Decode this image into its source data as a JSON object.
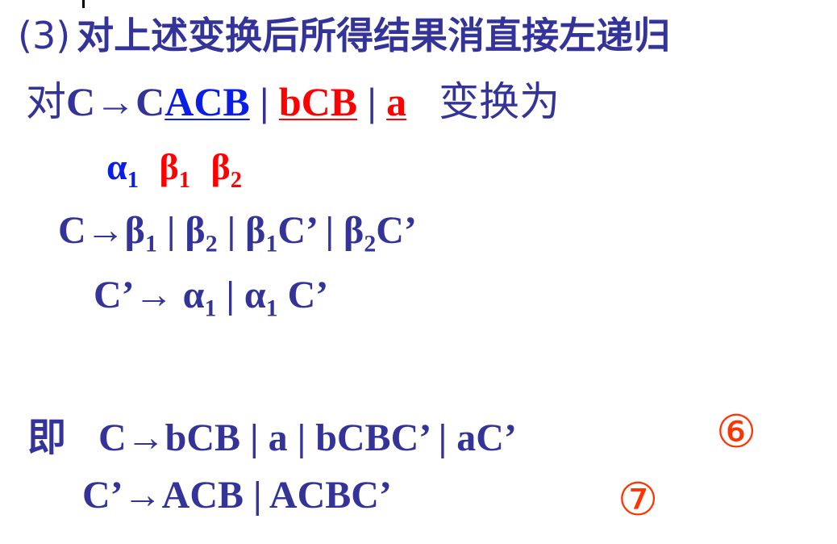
{
  "title": {
    "number": "(3)",
    "text": "对上述变换后所得结果消直接左递归"
  },
  "rule": {
    "prefix": "对",
    "lhs": "C→C",
    "alpha1": "ACB",
    "sep1": " | ",
    "beta1": "bCB",
    "sep2": " | ",
    "beta2": "a",
    "suffix": "变换为"
  },
  "labels": {
    "alpha": "α",
    "beta": "β",
    "sub1": "1",
    "sub2": "2"
  },
  "transform1": {
    "head": "C→",
    "beta": "β",
    "sub1": "1",
    "sep1": " | ",
    "sub2": "2",
    "sep2": " | ",
    "c1": "C’",
    "sep3": " | ",
    "c2": "C’"
  },
  "transform2": {
    "head": "C’→ ",
    "alpha": "α",
    "sub": "1",
    "sep": " | ",
    "tail": " C’"
  },
  "result": {
    "prefix": "即",
    "line1": "C→bCB | a | bCBC’ | aC’",
    "line2": "C’→ACB | ACBC’",
    "mark1": "⑥",
    "mark2": "⑦"
  }
}
